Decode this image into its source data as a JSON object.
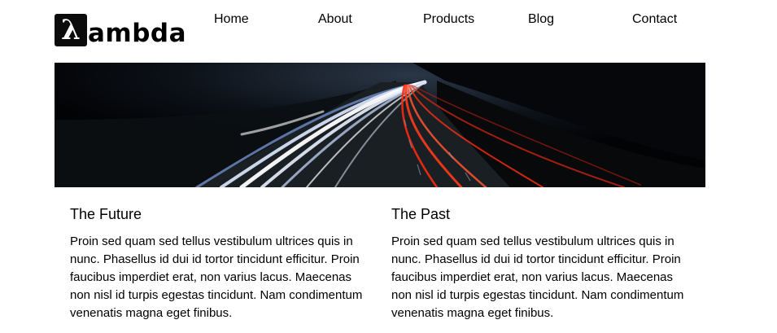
{
  "logo": {
    "mark": "λ",
    "text": "ambda"
  },
  "nav": {
    "items": [
      {
        "label": "Home"
      },
      {
        "label": "About"
      },
      {
        "label": "Products"
      },
      {
        "label": "Blog"
      },
      {
        "label": "Contact"
      }
    ]
  },
  "hero": {
    "image": "highway-light-trails-night-photo"
  },
  "columns": [
    {
      "title": "The Future",
      "body": "Proin sed quam sed tellus vestibulum ultrices quis in nunc. Phasellus id dui id tortor tincidunt efficitur. Proin faucibus imperdiet erat, non varius lacus. Maecenas non nisl id turpis egestas tincidunt. Nam condimentum venenatis magna eget finibus."
    },
    {
      "title": "The Past",
      "body": "Proin sed quam sed tellus vestibulum ultrices quis in nunc. Phasellus id dui id tortor tincidunt efficitur. Proin faucibus imperdiet erat, non varius lacus. Maecenas non nisl id turpis egestas tincidunt. Nam condimentum venenatis magna eget finibus."
    }
  ]
}
